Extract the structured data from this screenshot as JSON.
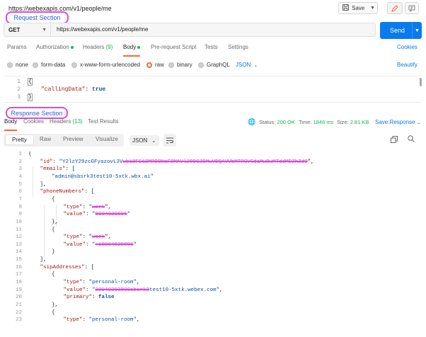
{
  "title": "https://webexapis.com/v1/people/me",
  "toolbar": {
    "save_label": "Save",
    "save_icon": "save-icon",
    "edit_icon": "edit-pencil-icon",
    "comment_icon": "comment-icon"
  },
  "annotations": {
    "request_section": "Request Section",
    "response_section": "Response Section"
  },
  "request": {
    "method": "GET",
    "url": "https://webexapis.com/v1/people/me",
    "send_label": "Send"
  },
  "request_tabs": {
    "params": "Params",
    "authorization": "Authorization",
    "headers": "Headers",
    "headers_count": "(9)",
    "body": "Body",
    "prerequest": "Pre-request Script",
    "tests": "Tests",
    "settings": "Settings",
    "cookies": "Cookies"
  },
  "body_types": {
    "none": "none",
    "form_data": "form-data",
    "urlencoded": "x-www-form-urlencoded",
    "raw": "raw",
    "binary": "binary",
    "graphql": "GraphQL",
    "format": "JSON",
    "beautify": "Beautify"
  },
  "request_body": {
    "lines": [
      {
        "n": "1",
        "open": "{"
      },
      {
        "n": "2",
        "key": "\"callingData\"",
        "sep": ": ",
        "val": "true"
      },
      {
        "n": "3",
        "open": "}"
      }
    ]
  },
  "response_tabs": {
    "body": "Body",
    "cookies": "Cookies",
    "headers": "Headers",
    "headers_count": "(13)",
    "test_results": "Test Results",
    "status_label": "Status:",
    "status_value": "200 OK",
    "time_label": "Time:",
    "time_value": "1846 ms",
    "size_label": "Size:",
    "size_value": "2.81 KB",
    "save_response": "Save Response",
    "globe_icon": "globe-icon"
  },
  "response_toolbar": {
    "pretty": "Pretty",
    "raw": "Raw",
    "preview": "Preview",
    "visualize": "Visualize",
    "format": "JSON",
    "wrap_icon": "wrap-lines-icon",
    "copy_icon": "copy-icon",
    "search_icon": "search-icon"
  },
  "response_body": {
    "lines": [
      {
        "n": "1",
        "indent": 0,
        "parts": [
          {
            "t": "{",
            "c": "punc"
          }
        ]
      },
      {
        "n": "2",
        "indent": 1,
        "parts": [
          {
            "t": "\"id\"",
            "c": "key"
          },
          {
            "t": ": ",
            "c": "punc"
          },
          {
            "t": "\"Y2lzY29zcGFyazovL3V",
            "c": "str"
          },
          {
            "t": "ub1BFS1BMRDBNaFBMAVl2ODG2DMwVDQAVVbMTRGVGdaMwBwMTddMDZhZdO",
            "c": "scribble"
          },
          {
            "t": "\",",
            "c": "punc"
          }
        ]
      },
      {
        "n": "3",
        "indent": 1,
        "parts": [
          {
            "t": "\"emails\"",
            "c": "key"
          },
          {
            "t": ": [",
            "c": "punc"
          }
        ]
      },
      {
        "n": "4",
        "indent": 2,
        "parts": [
          {
            "t": "\"admin@sbsrk3test10-5xtk.wbx.ai\"",
            "c": "str"
          }
        ]
      },
      {
        "n": "5",
        "indent": 1,
        "parts": [
          {
            "t": "],",
            "c": "punc"
          }
        ]
      },
      {
        "n": "6",
        "indent": 1,
        "parts": [
          {
            "t": "\"phoneNumbers\"",
            "c": "key"
          },
          {
            "t": ": [",
            "c": "punc"
          }
        ]
      },
      {
        "n": "7",
        "indent": 2,
        "parts": [
          {
            "t": "{",
            "c": "punc"
          }
        ]
      },
      {
        "n": "8",
        "indent": 3,
        "parts": [
          {
            "t": "\"type\"",
            "c": "key"
          },
          {
            "t": ": ",
            "c": "punc"
          },
          {
            "t": "\"",
            "c": "str"
          },
          {
            "t": "work",
            "c": "scribble"
          },
          {
            "t": "\",",
            "c": "punc"
          }
        ]
      },
      {
        "n": "9",
        "indent": 3,
        "parts": [
          {
            "t": "\"value\"",
            "c": "key"
          },
          {
            "t": ": ",
            "c": "punc"
          },
          {
            "t": "\"",
            "c": "str"
          },
          {
            "t": "8004029806",
            "c": "scribble"
          },
          {
            "t": "\"",
            "c": "str"
          }
        ]
      },
      {
        "n": "10",
        "indent": 2,
        "parts": [
          {
            "t": "},",
            "c": "punc"
          }
        ]
      },
      {
        "n": "11",
        "indent": 2,
        "parts": [
          {
            "t": "{",
            "c": "punc"
          }
        ]
      },
      {
        "n": "12",
        "indent": 3,
        "parts": [
          {
            "t": "\"type\"",
            "c": "key"
          },
          {
            "t": ": ",
            "c": "punc"
          },
          {
            "t": "\"",
            "c": "str"
          },
          {
            "t": "work",
            "c": "scribble"
          },
          {
            "t": "\",",
            "c": "punc"
          }
        ]
      },
      {
        "n": "13",
        "indent": 3,
        "parts": [
          {
            "t": "\"value\"",
            "c": "key"
          },
          {
            "t": ": ",
            "c": "punc"
          },
          {
            "t": "\"",
            "c": "str"
          },
          {
            "t": "+18004029806",
            "c": "scribble"
          },
          {
            "t": "\"",
            "c": "str"
          }
        ]
      },
      {
        "n": "14",
        "indent": 2,
        "parts": [
          {
            "t": "}",
            "c": "punc"
          }
        ]
      },
      {
        "n": "15",
        "indent": 1,
        "parts": [
          {
            "t": "],",
            "c": "punc"
          }
        ]
      },
      {
        "n": "16",
        "indent": 1,
        "parts": [
          {
            "t": "\"sipAddresses\"",
            "c": "key"
          },
          {
            "t": ": [",
            "c": "punc"
          }
        ]
      },
      {
        "n": "17",
        "indent": 2,
        "parts": [
          {
            "t": "{",
            "c": "punc"
          }
        ]
      },
      {
        "n": "18",
        "indent": 3,
        "parts": [
          {
            "t": "\"type\"",
            "c": "key"
          },
          {
            "t": ": ",
            "c": "punc"
          },
          {
            "t": "\"personal-room\"",
            "c": "str"
          },
          {
            "t": ",",
            "c": "punc"
          }
        ]
      },
      {
        "n": "19",
        "indent": 3,
        "parts": [
          {
            "t": "\"value\"",
            "c": "key"
          },
          {
            "t": ": ",
            "c": "punc"
          },
          {
            "t": "\"",
            "c": "str"
          },
          {
            "t": "28940293800ebsrk3",
            "c": "scribble"
          },
          {
            "t": "test10-5xtk.webex.com\"",
            "c": "str"
          },
          {
            "t": ",",
            "c": "punc"
          }
        ]
      },
      {
        "n": "20",
        "indent": 3,
        "parts": [
          {
            "t": "\"primary\"",
            "c": "key"
          },
          {
            "t": ": ",
            "c": "punc"
          },
          {
            "t": "false",
            "c": "kw"
          }
        ]
      },
      {
        "n": "21",
        "indent": 2,
        "parts": [
          {
            "t": "},",
            "c": "punc"
          }
        ]
      },
      {
        "n": "22",
        "indent": 2,
        "parts": [
          {
            "t": "{",
            "c": "punc"
          }
        ]
      },
      {
        "n": "23",
        "indent": 3,
        "parts": [
          {
            "t": "\"type\"",
            "c": "key"
          },
          {
            "t": ": ",
            "c": "punc"
          },
          {
            "t": "\"personal-room\"",
            "c": "str"
          },
          {
            "t": ",",
            "c": "punc"
          }
        ]
      }
    ]
  },
  "colors": {
    "accent": "#f26b3a",
    "send": "#097bed",
    "annotation": "#d94bd9",
    "status_ok": "#0cbb52"
  }
}
